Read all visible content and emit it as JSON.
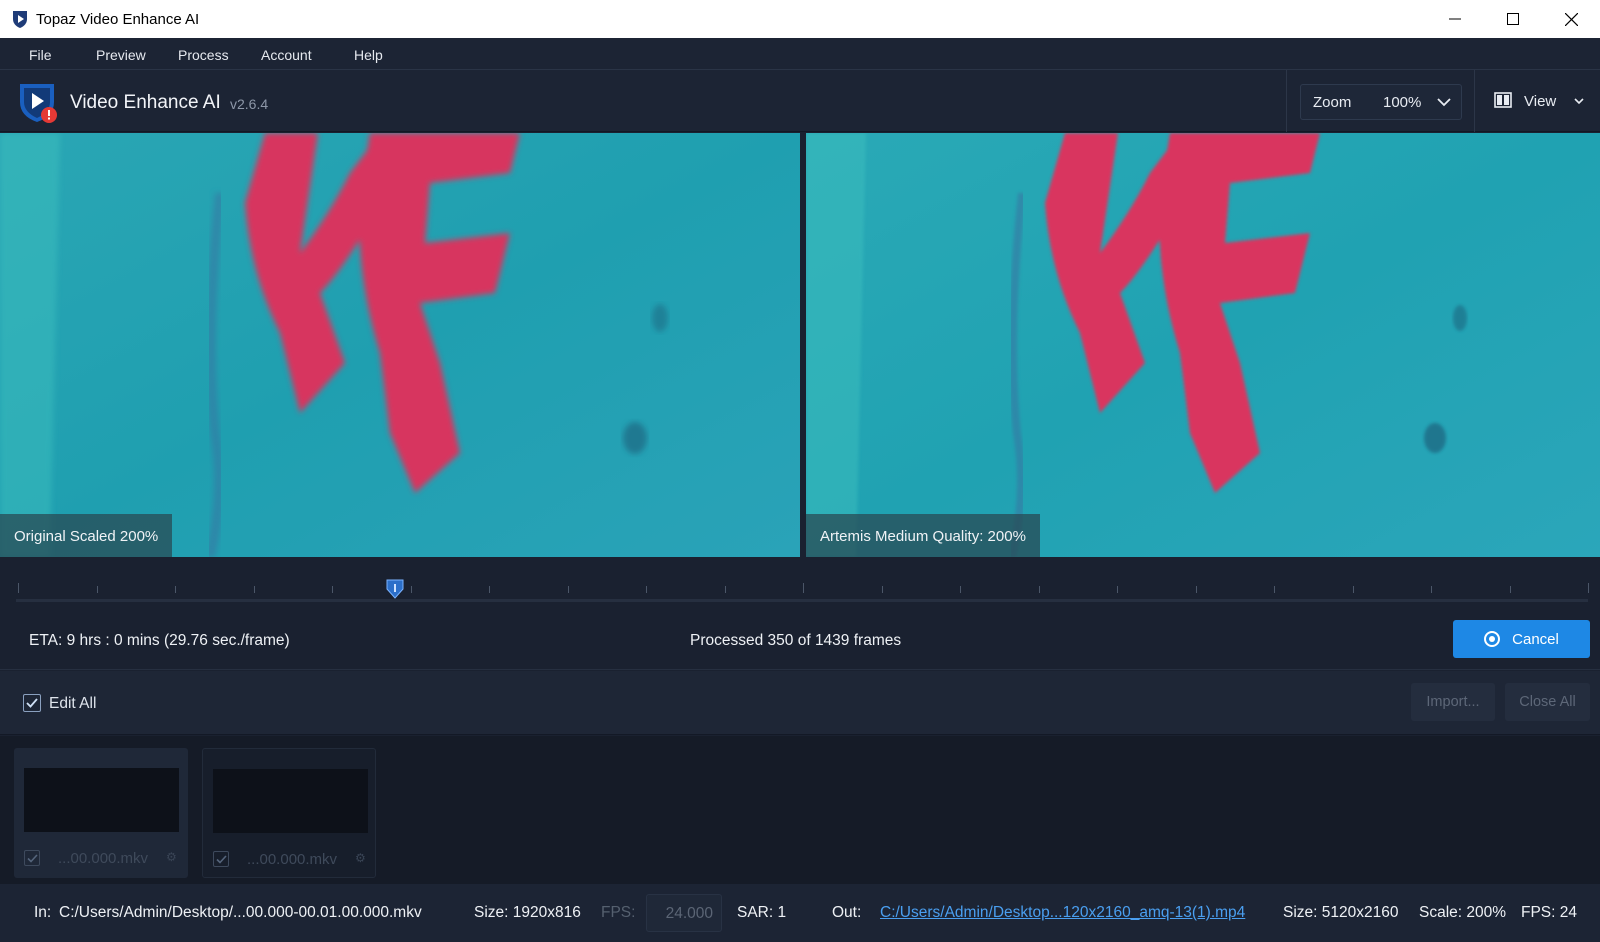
{
  "window": {
    "title": "Topaz Video Enhance AI"
  },
  "menu": [
    "File",
    "Preview",
    "Process",
    "Account",
    "Help"
  ],
  "header": {
    "app_name": "Video Enhance AI",
    "version": "v2.6.4",
    "zoom_label": "Zoom",
    "zoom_value": "100%",
    "view_label": "View"
  },
  "preview": {
    "left_label": "Original Scaled 200%",
    "right_label": "Artemis Medium Quality: 200%"
  },
  "timeline": {
    "playhead_fraction": 0.24
  },
  "progress": {
    "eta": "ETA:  9 hrs : 0 mins  (29.76 sec./frame)",
    "processed": "Processed 350 of 1439 frames",
    "cancel_label": "Cancel"
  },
  "edit_all": {
    "label": "Edit All",
    "checked": true,
    "import_label": "Import...",
    "close_all_label": "Close All"
  },
  "thumbnails": [
    {
      "name": "...00.000.mkv",
      "checked": true
    },
    {
      "name": "...00.000.mkv",
      "checked": true
    }
  ],
  "status": {
    "in_label": "In:",
    "in_path": "C:/Users/Admin/Desktop/...00.000-00.01.00.000.mkv",
    "in_size": "Size: 1920x816",
    "fps_label": "FPS:",
    "fps_value": "24.000",
    "sar": "SAR: 1",
    "out_label": "Out:",
    "out_path": "C:/Users/Admin/Desktop...120x2160_amq-13(1).mp4",
    "out_size": "Size: 5120x2160",
    "scale": "Scale: 200%",
    "fps_out": "FPS: 24"
  },
  "colors": {
    "accent": "#1e88e5",
    "background": "#1a2130",
    "preview_teal": "#2fa8b5",
    "graffiti_red": "#d8365e"
  }
}
